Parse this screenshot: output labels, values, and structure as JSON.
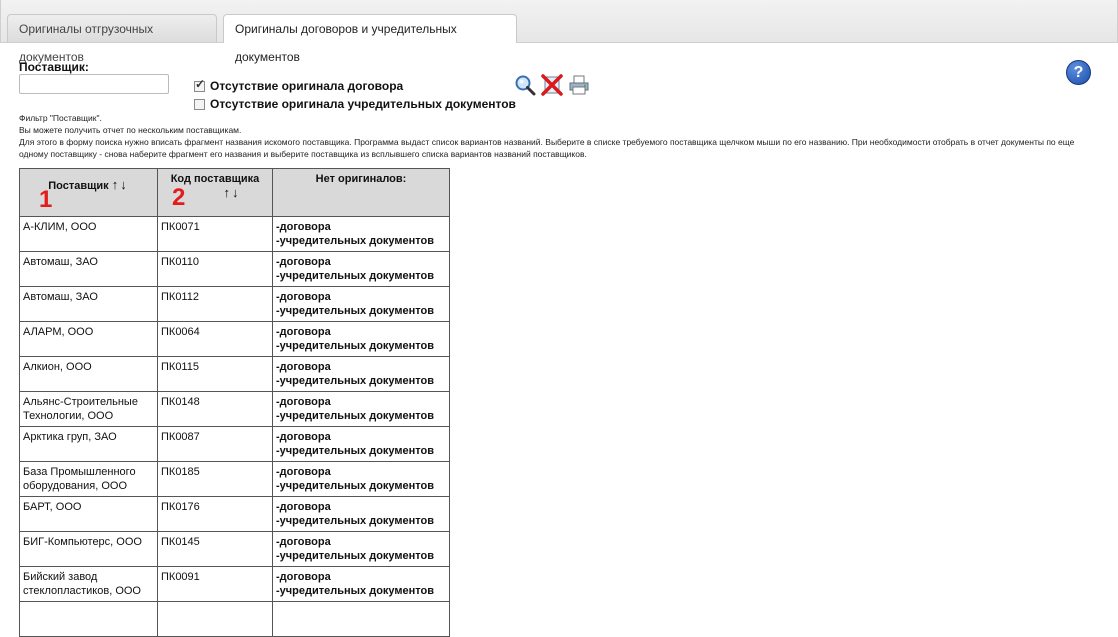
{
  "tabs": [
    {
      "label": "Оригиналы отгрузочных документов",
      "active": false
    },
    {
      "label": "Оригиналы договоров и учредительных документов",
      "active": true
    }
  ],
  "filter": {
    "supplier_label": "Поставщик:",
    "supplier_value": "",
    "checkbox_contract": {
      "label": "Отсутствие оригинала договора",
      "checked": true
    },
    "checkbox_founding": {
      "label": "Отсутствие оригинала учредительных документов",
      "checked": false
    }
  },
  "icons": [
    "search-icon",
    "clear-icon",
    "print-icon",
    "help-icon"
  ],
  "help_glyph": "?",
  "description": {
    "line1": "Фильтр \"Поставщик\".",
    "line2": "Вы можете получить отчет по нескольким поставщикам.",
    "line3": "Для этого в форму поиска нужно вписать фрагмент названия искомого поставщика. Программа выдаст список вариантов названий. Выберите в списке требуемого поставщика щелчком мыши по его названию. При необходимости отобрать в отчет документы по еще одному поставщику - снова наберите фрагмент его названия и выберите поставщика из всплывшего списка вариантов названий поставщиков."
  },
  "table": {
    "headers": {
      "supplier": "Поставщик",
      "code": "Код поставщика",
      "missing": "Нет оригиналов:"
    },
    "sort_arrows": "↑↓",
    "annotations": {
      "mark1": "1",
      "mark2": "2"
    },
    "rows": [
      {
        "supplier": "А-КЛИМ, ООО",
        "code": "ПК0071",
        "m1": "-договора",
        "m2": "-учредительных документов"
      },
      {
        "supplier": "Автомаш, ЗАО",
        "code": "ПК0110",
        "m1": "-договора",
        "m2": "-учредительных документов"
      },
      {
        "supplier": "Автомаш, ЗАО",
        "code": "ПК0112",
        "m1": "-договора",
        "m2": "-учредительных документов"
      },
      {
        "supplier": "АЛАРМ, ООО",
        "code": "ПК0064",
        "m1": "-договора",
        "m2": "-учредительных документов"
      },
      {
        "supplier": "Алкион, ООО",
        "code": "ПК0115",
        "m1": "-договора",
        "m2": "-учредительных документов"
      },
      {
        "supplier": "Альянс-Строительные Технологии, ООО",
        "code": "ПК0148",
        "m1": "-договора",
        "m2": "-учредительных документов"
      },
      {
        "supplier": "Арктика груп, ЗАО",
        "code": "ПК0087",
        "m1": "-договора",
        "m2": "-учредительных документов"
      },
      {
        "supplier": "База Промышленного оборудования, ООО",
        "code": "ПК0185",
        "m1": "-договора",
        "m2": "-учредительных документов"
      },
      {
        "supplier": "БАРТ, ООО",
        "code": "ПК0176",
        "m1": "-договора",
        "m2": "-учредительных документов"
      },
      {
        "supplier": "БИГ-Компьютерс, ООО",
        "code": "ПК0145",
        "m1": "-договора",
        "m2": "-учредительных документов"
      },
      {
        "supplier": "Бийский завод стеклопластиков, ООО",
        "code": "ПК0091",
        "m1": "-договора",
        "m2": "-учредительных документов"
      },
      {
        "supplier": "",
        "code": "",
        "m1": "",
        "m2": ""
      }
    ]
  }
}
